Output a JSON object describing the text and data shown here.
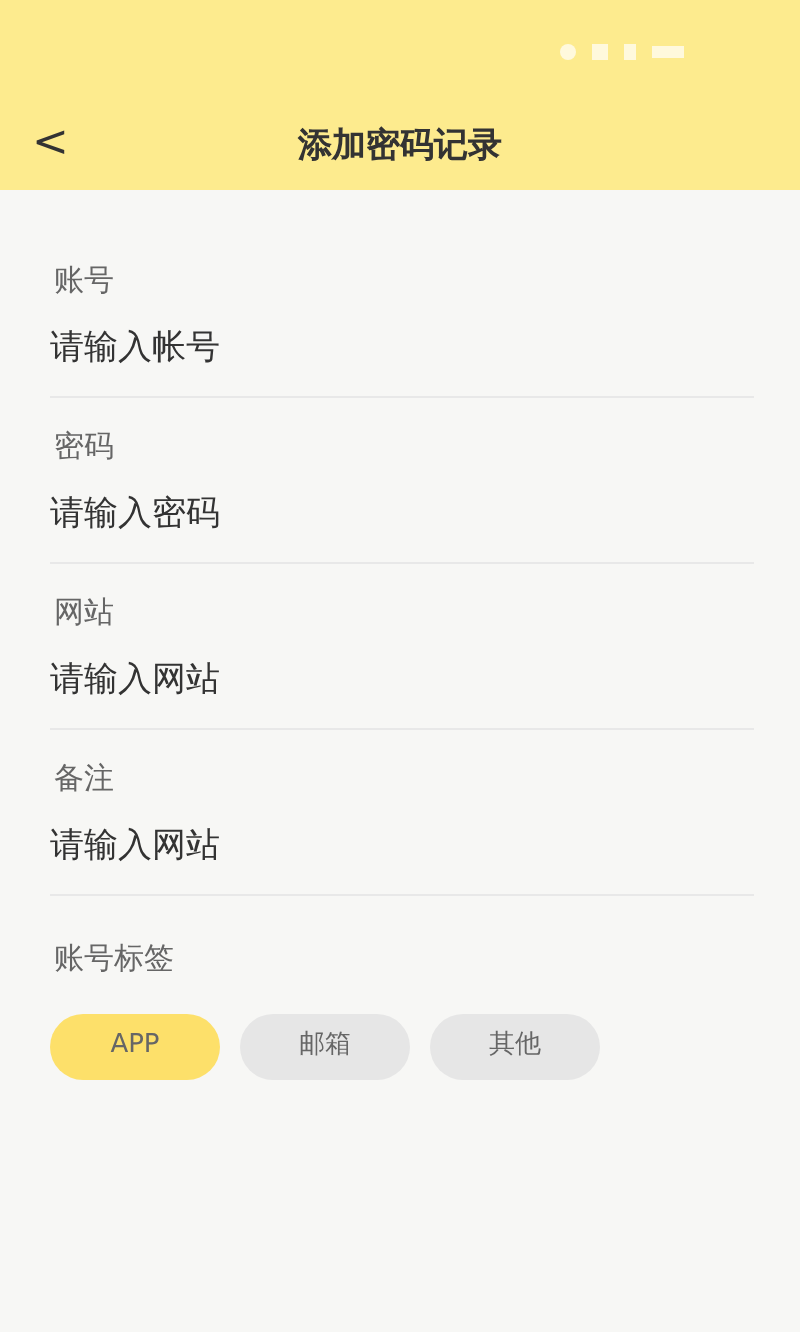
{
  "header": {
    "back": "<",
    "title": "添加密码记录"
  },
  "fields": [
    {
      "label": "账号",
      "placeholder": "请输入帐号"
    },
    {
      "label": "密码",
      "placeholder": "请输入密码"
    },
    {
      "label": "网站",
      "placeholder": "请输入网站"
    },
    {
      "label": "备注",
      "placeholder": "请输入网站"
    }
  ],
  "tags": {
    "label": "账号标签",
    "items": [
      {
        "label": "APP",
        "selected": true
      },
      {
        "label": "邮箱",
        "selected": false
      },
      {
        "label": "其他",
        "selected": false
      }
    ]
  }
}
